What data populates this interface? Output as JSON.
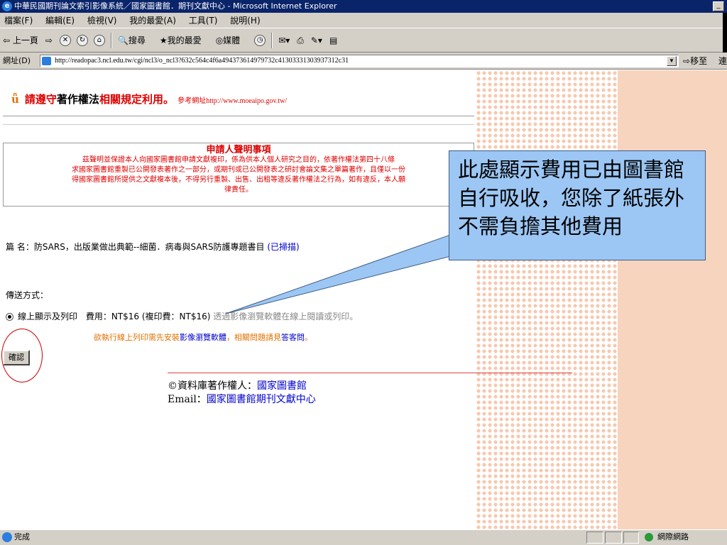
{
  "window": {
    "title": "中華民國期刊論文索引影像系統／國家圖書館．期刊文獻中心 - Microsoft Internet Explorer"
  },
  "menu": [
    "檔案(F)",
    "編輯(E)",
    "檢視(V)",
    "我的最愛(A)",
    "工具(T)",
    "說明(H)"
  ],
  "toolbar": {
    "back": "⇦ 上一頁",
    "forward": "⇨",
    "search": "搜尋",
    "favorites": "我的最愛",
    "media": "媒體"
  },
  "address": {
    "label": "網址(D)",
    "url": "http://readopac3.ncl.edu.tw/cgi/ncl3/o_ncl3?632c564c4f6a494373614979732c41303331303937312c31",
    "go": "移至",
    "links": "連"
  },
  "content": {
    "warn_pre": "請遵守",
    "warn_mid": "著作權法",
    "warn_red": "相關規定利用",
    "warn_end": "。",
    "ref_label": "參考網址",
    "ref_url": "http://www.moeaipo.gov.tw/",
    "declare_title": "申請人聲明事項",
    "declare_lines": [
      "茲聲明並保證本人向國家圖書館申請文獻複印，係為供本人個人研究之目的，依著作權法第四十八條",
      "求國家圖書館重製已公開發表著作之一部分，或期刊或已公開發表之研討會論文集之單篇著作，且僅以一份",
      "得國家圖書館所提供之文獻複本後，不得另行重製、出售、出租等違反著作權法之行為，如有違反，本人願",
      "律責任。"
    ],
    "article_label": "篇 名：",
    "article_title": "防SARS，出版業做出典範--細菌．病毒與SARS防護專題書目",
    "article_status": "(已掃描)",
    "delivery_label": "傳送方式：",
    "option_label": "線上顯示及列印",
    "fee_text": "費用：NT$16 (複印費：NT$16)",
    "fee_note": "透過影像瀏覽軟體在線上閱讀或列印。",
    "install_pre": "欲執行線上列印需先安裝",
    "install_link": "影像瀏覽軟體",
    "install_mid": "，相關問題請見",
    "install_faq": "答客問",
    "install_end": "。",
    "confirm_button": "確認",
    "copyright_label": "©資料庫著作權人：",
    "copyright_owner": "國家圖書館",
    "email_label": "Email：",
    "email_value": "國家圖書館期刊文獻中心"
  },
  "callout": {
    "text": "此處顯示費用已由圖書館自行吸收，您除了紙張外不需負擔其他費用"
  },
  "status": {
    "text": "完成",
    "zone": "網際網路"
  },
  "colors": {
    "accent_red": "#dd0000",
    "link_blue": "#0000cc",
    "callout_bg": "#9cc7f5",
    "page_side": "#f6d4bd"
  }
}
